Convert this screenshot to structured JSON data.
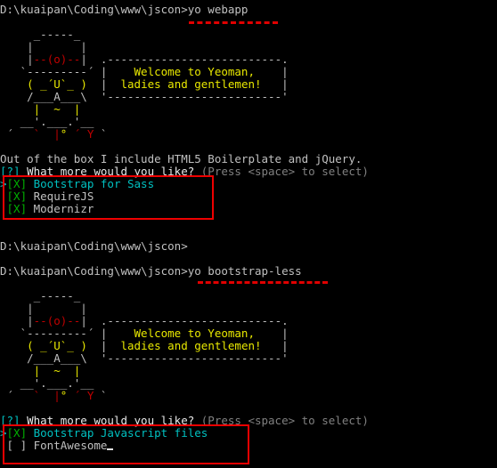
{
  "colors": {
    "background": "#000000",
    "text": "#c0c0c0",
    "yeoman_red": "#c00000",
    "yeoman_yellow": "#e8e800",
    "checkbox_green": "#00b000",
    "question_mark": "#00c0c0",
    "hint_gray": "#808080",
    "annotation_red": "#ee0000"
  },
  "session1": {
    "prompt": "D:\\kuaipan\\Coding\\www\\jscon>",
    "command": "yo webapp",
    "logo": {
      "l1": "     _-----_",
      "l2a": "    |       |",
      "l3a": "    |",
      "l3b": "--(o)--",
      "l3c": "|",
      "l4a": "   `---------´",
      "l5a": "    ( _",
      "l5b": "´U`",
      "l5c": "_ )",
      "l6a": "    /___A___\\",
      "l7a": "     |  ~  |",
      "l8a": "   __",
      "l8b": "'.___.'",
      "l8c": "__",
      "l9a": " ´   ",
      "l9b": "`  |",
      "l9c": "° ",
      "l9d": "´ Y ",
      "l9e": "`",
      "box_top": "  .--------------------------.",
      "box_side_a": " |",
      "box_side_b": "|",
      "box_bottom": "  '--------------------------'",
      "welcome_1": "    Welcome to Yeoman,    ",
      "welcome_2": "  ladies and gentlemen!   "
    },
    "intro": "Out of the box I include HTML5 Boilerplate and jQuery.",
    "question_mark": "[?]",
    "question": " What more would you like?",
    "hint": " (Press <space> to select)",
    "options": [
      {
        "pointer": ">",
        "mark": "[X]",
        "label": " Bootstrap for Sass"
      },
      {
        "pointer": " ",
        "mark": "[X]",
        "label": " RequireJS"
      },
      {
        "pointer": " ",
        "mark": "[X]",
        "label": " Modernizr"
      }
    ]
  },
  "session_blank": {
    "prompt": "D:\\kuaipan\\Coding\\www\\jscon>"
  },
  "session2": {
    "prompt": "D:\\kuaipan\\Coding\\www\\jscon>",
    "command": "yo bootstrap-less",
    "question_mark": "[?]",
    "question": " What more would you like?",
    "hint": " (Press <space> to select)",
    "options": [
      {
        "pointer": ">",
        "mark": "[X]",
        "label": " Bootstrap Javascript files"
      },
      {
        "pointer": " ",
        "mark": "[ ]",
        "label": " FontAwesome"
      }
    ]
  }
}
